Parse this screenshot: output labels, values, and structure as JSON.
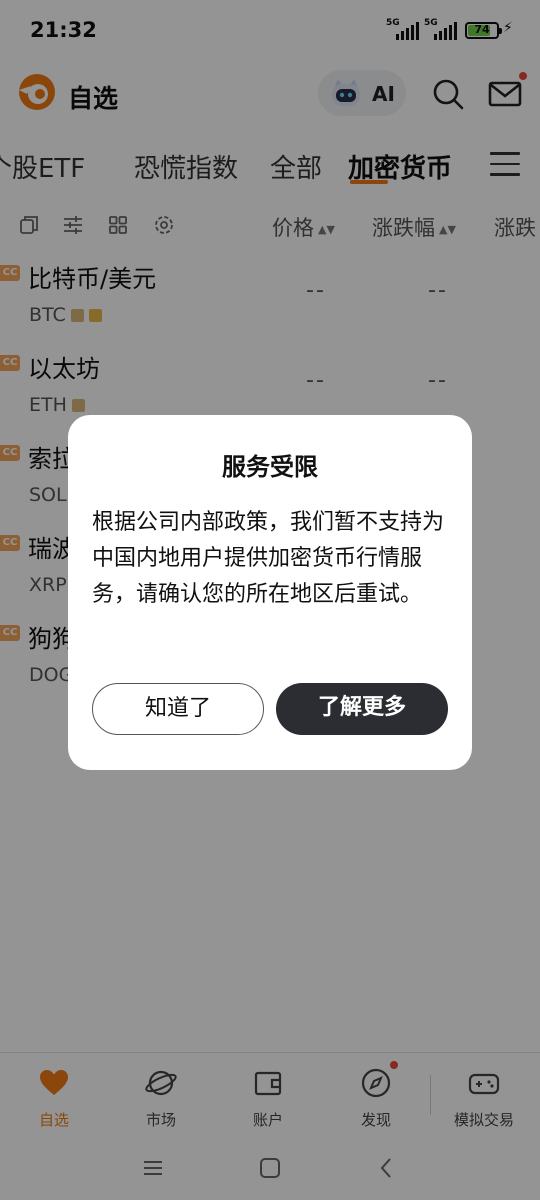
{
  "status_bar": {
    "time": "21:32",
    "signal_1": "5G",
    "signal_2": "5G",
    "battery": "74"
  },
  "header": {
    "title": "自选",
    "ai_label": "AI"
  },
  "tabs": [
    {
      "label": "个股ETF"
    },
    {
      "label": "恐慌指数"
    },
    {
      "label": "全部"
    },
    {
      "label": "加密货币"
    }
  ],
  "columns": {
    "price": "价格",
    "change_pct": "涨跌幅",
    "change": "涨跌"
  },
  "rows": [
    {
      "badge": "CC",
      "name": "比特币/美元",
      "symbol": "BTC",
      "price": "--",
      "change_pct": "--"
    },
    {
      "badge": "CC",
      "name": "以太坊",
      "symbol": "ETH",
      "price": "--",
      "change_pct": "--"
    },
    {
      "badge": "CC",
      "name": "索拉",
      "symbol": "SOL"
    },
    {
      "badge": "CC",
      "name": "瑞波",
      "symbol": "XRP"
    },
    {
      "badge": "CC",
      "name": "狗狗",
      "symbol": "DOG"
    }
  ],
  "bottom_nav": [
    {
      "label": "自选",
      "icon": "heart-icon"
    },
    {
      "label": "市场",
      "icon": "planet-icon"
    },
    {
      "label": "账户",
      "icon": "wallet-icon"
    },
    {
      "label": "发现",
      "icon": "compass-icon"
    },
    {
      "label": "模拟交易",
      "icon": "gamepad-icon"
    }
  ],
  "dialog": {
    "title": "服务受限",
    "message": "根据公司内部政策，我们暂不支持为中国内地用户提供加密货币行情服务，请确认您的所在地区后重试。",
    "cancel_label": "知道了",
    "confirm_label": "了解更多"
  },
  "colors": {
    "accent": "#f07a14",
    "badge": "#f2a45a",
    "primary_button": "#2b2d33",
    "overlay": "rgba(0,0,0,0.42)"
  }
}
